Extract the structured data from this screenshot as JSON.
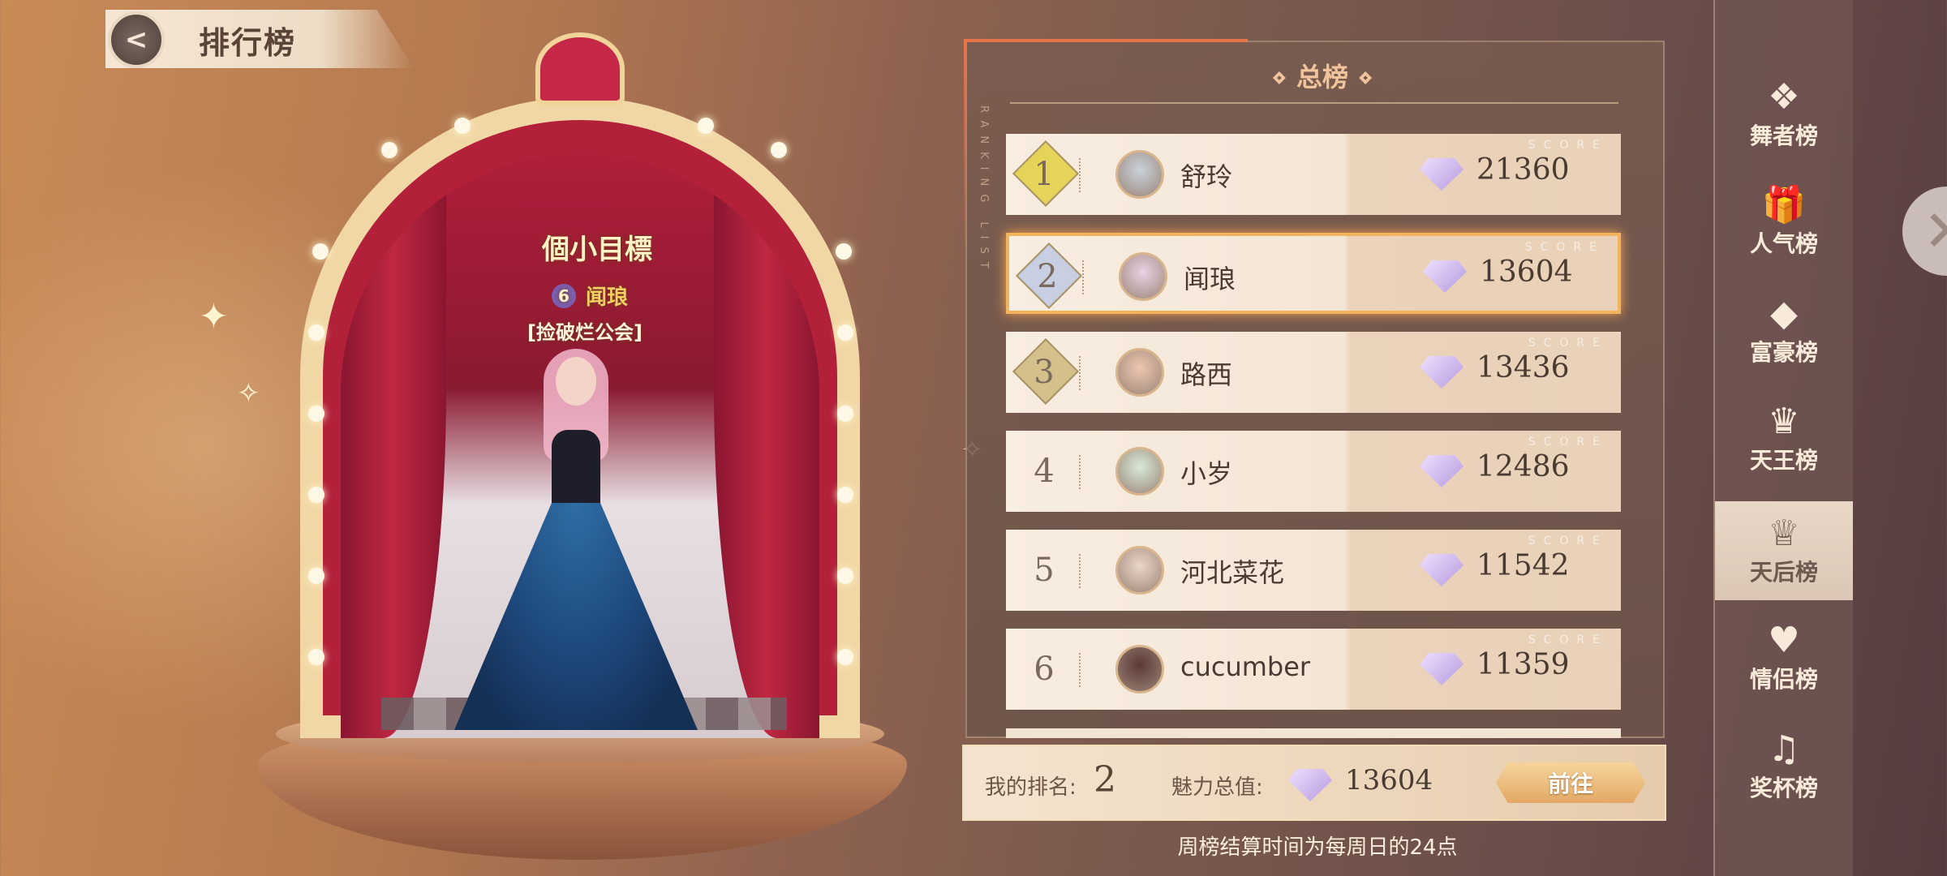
{
  "header": {
    "back_icon": "back-arrow-icon",
    "title": "排行榜"
  },
  "stage": {
    "banner_text": "個小目標",
    "player_level": "6",
    "player_name": "闻琅",
    "guild": "[捡破烂公会]"
  },
  "panel": {
    "title": "总榜",
    "side_text": "RANKING LIST",
    "score_deco": "SCORE",
    "rows": [
      {
        "rank": "1",
        "name": "舒玲",
        "score": "21360",
        "badge_color": "#e6d45a",
        "avatar_color": "#c9d2dc",
        "selected": false
      },
      {
        "rank": "2",
        "name": "闻琅",
        "score": "13604",
        "badge_color": "#c8cfe3",
        "avatar_color": "#e9d3e6",
        "selected": true
      },
      {
        "rank": "3",
        "name": "路西",
        "score": "13436",
        "badge_color": "#d4c08a",
        "avatar_color": "#edc7b0",
        "selected": false
      },
      {
        "rank": "4",
        "name": "小岁",
        "score": "12486",
        "badge_color": "",
        "avatar_color": "#d8ead8",
        "selected": false
      },
      {
        "rank": "5",
        "name": "河北菜花",
        "score": "11542",
        "badge_color": "",
        "avatar_color": "#ead6c9",
        "selected": false
      },
      {
        "rank": "6",
        "name": "cucumber",
        "score": "11359",
        "badge_color": "",
        "avatar_color": "#5a3a35",
        "selected": false
      }
    ]
  },
  "footer": {
    "my_rank_label": "我的排名:",
    "my_rank": "2",
    "charm_label": "魅力总值:",
    "charm_value": "13604",
    "go_button": "前往",
    "note": "周榜结算时间为每周日的24点"
  },
  "nav": {
    "items": [
      {
        "label": "舞者榜",
        "icon": "dancer-wings-icon",
        "glyph": "❖",
        "active": false
      },
      {
        "label": "人气榜",
        "icon": "gift-icon",
        "glyph": "🎁",
        "active": false
      },
      {
        "label": "富豪榜",
        "icon": "diamond-icon",
        "glyph": "◆",
        "active": false
      },
      {
        "label": "天王榜",
        "icon": "crown-icon",
        "glyph": "♛",
        "active": false
      },
      {
        "label": "天后榜",
        "icon": "queen-icon",
        "glyph": "♕",
        "active": true
      },
      {
        "label": "情侣榜",
        "icon": "hearts-icon",
        "glyph": "♥",
        "active": false
      },
      {
        "label": "奖杯榜",
        "icon": "trophy-record-icon",
        "glyph": "♫",
        "active": false
      }
    ]
  },
  "colors": {
    "accent": "#e8744a",
    "selected_border": "#f2b35c"
  }
}
